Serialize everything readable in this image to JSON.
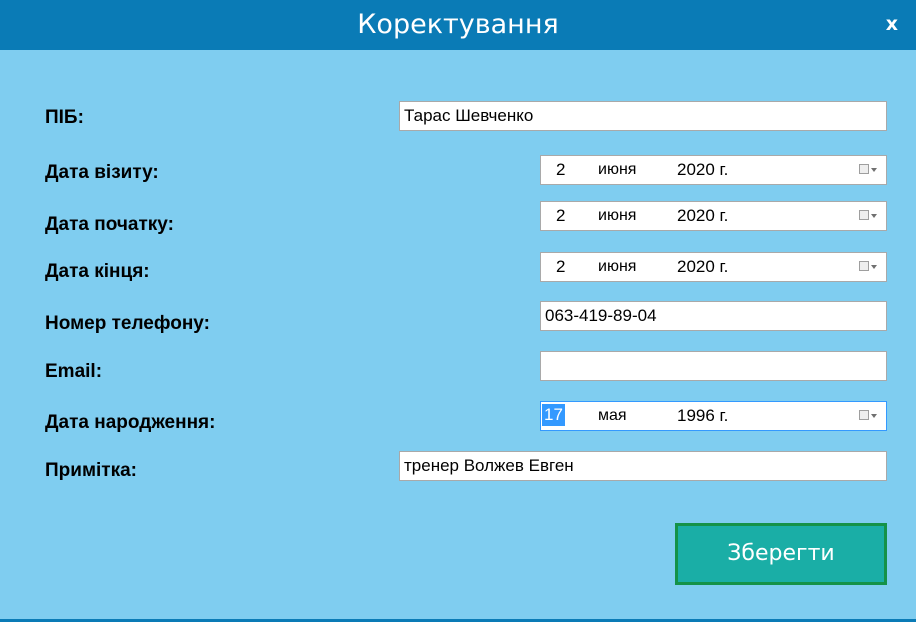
{
  "window": {
    "title": "Коректування",
    "close_label": "x"
  },
  "form": {
    "pib": {
      "label": "ПІБ:",
      "value": "Тарас Шевченко"
    },
    "visit_date": {
      "label": "Дата візиту:",
      "day": "2",
      "month": "июня",
      "year": "2020 г."
    },
    "start_date": {
      "label": "Дата початку:",
      "day": "2",
      "month": "июня",
      "year": "2020 г."
    },
    "end_date": {
      "label": "Дата кінця:",
      "day": "2",
      "month": "июня",
      "year": "2020 г."
    },
    "phone": {
      "label": "Номер телефону:",
      "value": "063-419-89-04"
    },
    "email": {
      "label": "Email:",
      "value": ""
    },
    "birth_date": {
      "label": "Дата народження:",
      "day": "17",
      "month": "мая",
      "year": "1996 г."
    },
    "note": {
      "label": "Примітка:",
      "value": "тренер Волжев Евген"
    },
    "save_label": "Зберегти"
  },
  "icons": {
    "calendar_dropdown": "calendar-dropdown-icon"
  },
  "colors": {
    "titlebar": "#0a7bb6",
    "background": "#7fcdf0",
    "save_button": "#1aaea6",
    "save_border": "#149248",
    "selection": "#3399ff"
  }
}
